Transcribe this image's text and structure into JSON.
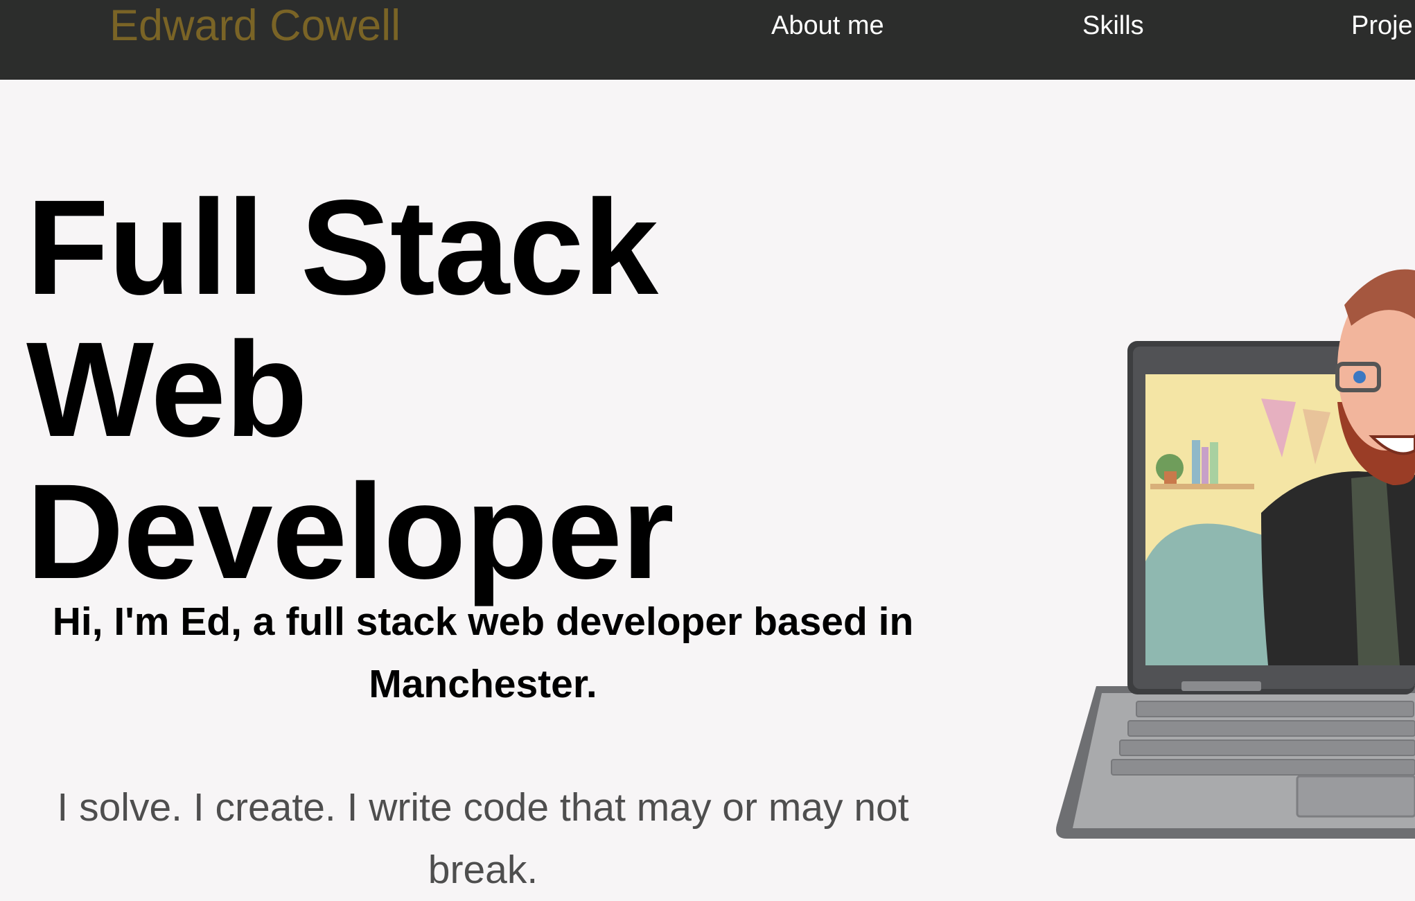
{
  "nav": {
    "brand": "Edward Cowell",
    "links": [
      {
        "label": "About me"
      },
      {
        "label": "Skills"
      },
      {
        "label": "Proje"
      }
    ]
  },
  "hero": {
    "title": "Full Stack Web Developer",
    "intro": "Hi, I'm Ed, a full stack web developer based in Manchester.",
    "tagline": "I solve. I create. I write code that may or may not break."
  },
  "colors": {
    "navbar_bg": "#2c2d2c",
    "brand": "#7a6426",
    "page_bg": "#f7f5f6"
  }
}
